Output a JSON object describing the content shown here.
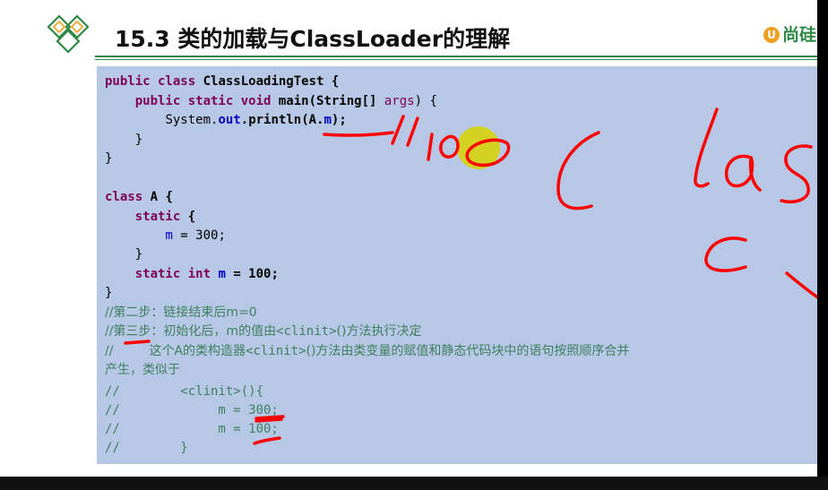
{
  "slide": {
    "title": "15.3 类的加载与ClassLoader的理解",
    "brand": "尚硅",
    "brand_symbol": "U"
  },
  "code": {
    "l1": {
      "kw1": "public class",
      "name": " ClassLoadingTest {"
    },
    "l2": {
      "indent": "    ",
      "kw1": "public static void",
      "main": " main(String[] ",
      "args": "args",
      "end": ") {"
    },
    "l3": {
      "indent": "        ",
      "sys": "System.",
      "out": "out",
      "dot": ".",
      "println": "println(A.",
      "m": "m",
      "end": ");"
    },
    "l4": "    }",
    "l5": "}",
    "l6": {
      "kw1": "class",
      "name": " A {"
    },
    "l7": {
      "indent": "    ",
      "kw1": "static",
      "end": " {"
    },
    "l8": {
      "indent": "        ",
      "m": "m",
      "rest": " = 300;"
    },
    "l9": "    }",
    "l10": {
      "indent": "    ",
      "kw1": "static int",
      "sp": " ",
      "m": "m",
      "rest": " = 100;"
    },
    "l11": "}"
  },
  "comments": {
    "c1": "//第二步：链接结束后m=0",
    "c2_a": "//第三步：初始化后，m的值由",
    "c2_b": "<clinit>",
    "c2_c": "()方法执行决定",
    "c3_a": "//         这个A的类构造器",
    "c3_b": "<clinit>",
    "c3_c": "()方法由类变量的赋值和静态代码块中的语句按照顺序合并",
    "c4": "产生，类似于",
    "c5": "//        <clinit>(){",
    "c6": "//             m = 300;",
    "c7": "//             m = 100;",
    "c8": "//        }"
  },
  "colors": {
    "code_background": "#b6c8e6",
    "keyword": "#7f0055",
    "field": "#0000c0",
    "comment": "#3f7f5f",
    "title_rule": "#2d8a45",
    "ink": "#ff0000",
    "highlight": "#d8d400"
  },
  "icons": {
    "logo": "diamond-knot-logo-icon",
    "pointer": "laser-pointer-highlight"
  },
  "annotations": {
    "handwritten": "//100  class  c"
  }
}
